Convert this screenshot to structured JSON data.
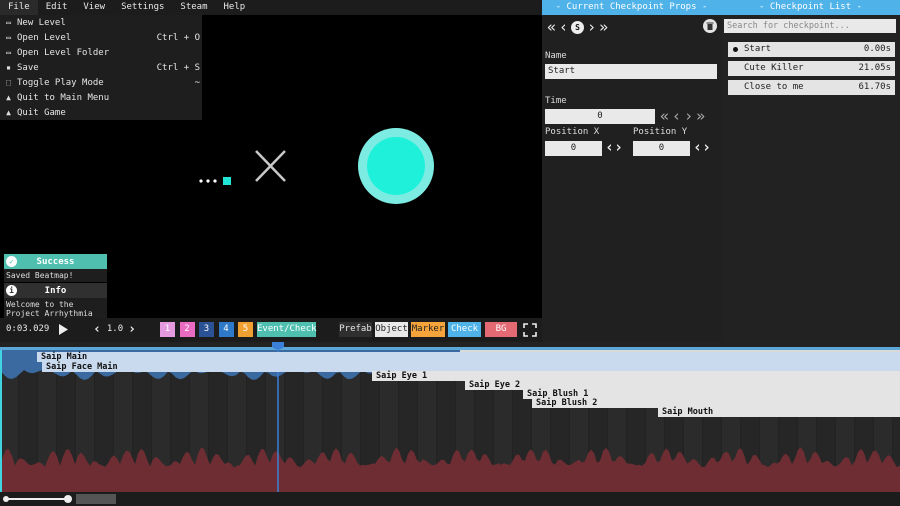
{
  "menu": {
    "items": [
      "File",
      "Edit",
      "View",
      "Settings",
      "Steam",
      "Help"
    ],
    "file_dropdown": [
      {
        "label": "New Level",
        "shortcut": "",
        "icon": "folder-icon"
      },
      {
        "label": "Open Level",
        "shortcut": "Ctrl + O",
        "icon": "folder-open-icon"
      },
      {
        "label": "Open Level Folder",
        "shortcut": "",
        "icon": "folder-icon"
      },
      {
        "label": "Save",
        "shortcut": "Ctrl + S",
        "icon": "save-icon"
      },
      {
        "label": "Toggle Play Mode",
        "shortcut": "~",
        "icon": "play-mode-icon"
      },
      {
        "label": "Quit to Main Menu",
        "shortcut": "",
        "icon": "warning-icon"
      },
      {
        "label": "Quit Game",
        "shortcut": "",
        "icon": "warning-icon"
      }
    ]
  },
  "notifications": [
    {
      "title": "Success",
      "message": "Saved Beatmap!",
      "color": "#4fc0b0",
      "icon": "check-icon"
    },
    {
      "title": "Info",
      "message": "Welcome to the Project Arrhythmia Editor!",
      "color": "#303030",
      "icon": "info-icon"
    }
  ],
  "controls": {
    "time": "0:03.029",
    "speed": "1.0",
    "layers": [
      "1",
      "2",
      "3",
      "4",
      "5"
    ],
    "layer_colors": [
      "#e59ae0",
      "#e96bc2",
      "#2a5294",
      "#2e79c9",
      "#f0a030"
    ],
    "event_check": "Event/Check",
    "modes": [
      {
        "label": "Prefab",
        "bg": "#2f2f2f",
        "fg": "#e6e6e6"
      },
      {
        "label": "Object",
        "bg": "#e9e9e9",
        "fg": "#222"
      },
      {
        "label": "Marker",
        "bg": "#f4a43a",
        "fg": "#222"
      },
      {
        "label": "Check",
        "bg": "#4fb3ea",
        "fg": "#fff"
      },
      {
        "label": "BG",
        "bg": "#e36a73",
        "fg": "#fff"
      }
    ]
  },
  "props": {
    "title": "- Current Checkpoint Props -",
    "nav_letter": "S",
    "name_label": "Name",
    "name_value": "Start",
    "time_label": "Time",
    "time_value": "0",
    "posx_label": "Position X",
    "posy_label": "Position Y",
    "posx_value": "0",
    "posy_value": "0"
  },
  "checkpoints": {
    "title": "- Checkpoint List -",
    "search_placeholder": "Search for checkpoint...",
    "items": [
      {
        "name": "Start",
        "time": "0.00s"
      },
      {
        "name": "Cute Killer",
        "time": "21.05s"
      },
      {
        "name": "Close to me",
        "time": "61.70s"
      }
    ]
  },
  "timeline_objects": [
    {
      "label": "Saip Main"
    },
    {
      "label": "Saip Face Main"
    },
    {
      "label": "Saip Eye 1"
    },
    {
      "label": "Saip Eye 2"
    },
    {
      "label": "Saip Blush 1"
    },
    {
      "label": "Saip Blush 2"
    },
    {
      "label": "Saip Mouth"
    }
  ]
}
